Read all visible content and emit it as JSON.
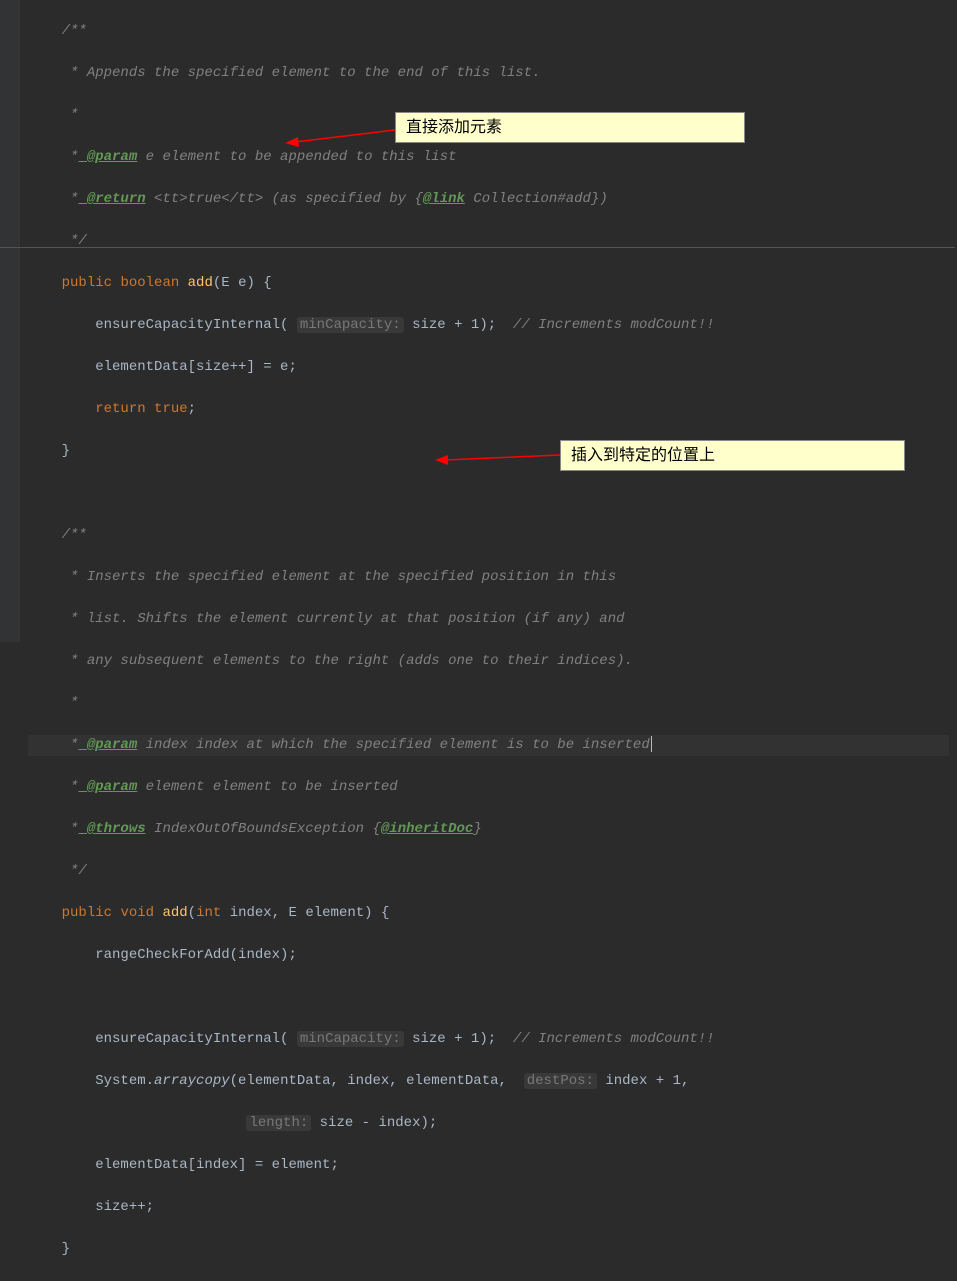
{
  "annotations": {
    "box1": "直接添加元素",
    "box2": "插入到特定的位置上"
  },
  "code": {
    "m1": {
      "jd_open": "/**",
      "jd1": " * Appends the specified element to the end of this list.",
      "jd_star": " *",
      "jd_param": " @param",
      "jd_param_text": " e element to be appended to this list",
      "jd_return": " @return",
      "jd_return_text1": " <tt>true</tt> (as specified by {",
      "jd_link": "@link",
      "jd_return_text2": " Collection#add",
      "jd_return_text3": "})",
      "jd_close": " */",
      "sig_public": "public",
      "sig_boolean": "boolean",
      "sig_add": "add",
      "sig_E": "E",
      "sig_e": "e",
      "l1a": "ensureCapacityInternal(",
      "l1hint": "minCapacity:",
      "l1b": " size + ",
      "l1c": "1",
      "l1d": ");  ",
      "l1e": "// Increments modCount!!",
      "l2a": "elementData[size++] = e;",
      "l3a": "return",
      "l3b": "true",
      "l3c": ";"
    },
    "m2": {
      "jd_open": "/**",
      "jd1": " * Inserts the specified element at the specified position in this",
      "jd2": " * list. Shifts the element currently at that position (if any) and",
      "jd3": " * any subsequent elements to the right (adds one to their indices).",
      "jd_star": " *",
      "jd_p1": " @param",
      "jd_p1t": " index index at which the specified element is to be inserted",
      "jd_p2": " @param",
      "jd_p2t": " element element to be inserted",
      "jd_t": " @throws",
      "jd_tt1": " IndexOutOfBoundsException {",
      "jd_inh": "@inheritDoc",
      "jd_tt2": "}",
      "jd_close": " */",
      "sig_public": "public",
      "sig_void": "void",
      "sig_add": "add",
      "sig_int": "int",
      "sig_index": "index",
      "sig_E": "E",
      "sig_element": "element",
      "l1": "rangeCheckForAdd(index);",
      "l2a": "ensureCapacityInternal(",
      "l2hint": "minCapacity:",
      "l2b": " size + ",
      "l2c": "1",
      "l2d": ");  ",
      "l2e": "// Increments modCount!!",
      "l3a": "System.",
      "l3b": "arraycopy",
      "l3c": "(elementData, index, elementData, ",
      "l3hint": "destPos:",
      "l3d": " index + ",
      "l3e": "1",
      "l3f": ",",
      "l4hint": "length:",
      "l4a": " size - index);",
      "l5": "elementData[index] = element;",
      "l6": "size++;"
    }
  }
}
